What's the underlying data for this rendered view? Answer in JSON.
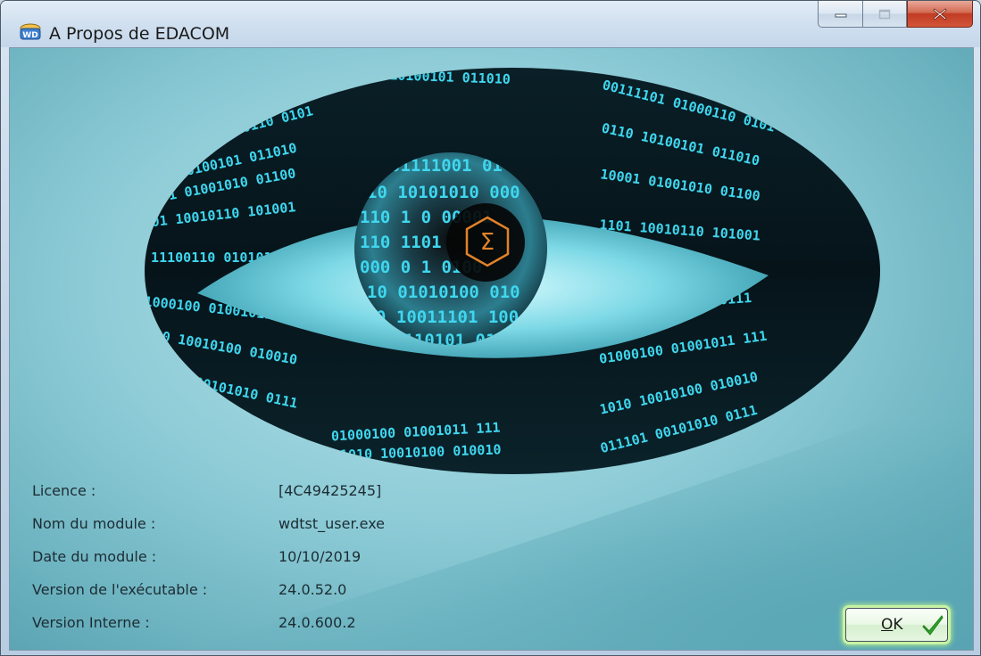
{
  "window": {
    "title": "A Propos de EDACOM",
    "app_icon": "windev-icon"
  },
  "caption_buttons": {
    "minimize": "minimize-icon",
    "maximize": "maximize-icon",
    "close": "close-icon"
  },
  "hero": {
    "description": "eye-graphic",
    "emblem_symbol": "Σ",
    "binary_rows": [
      "00111101 01000110 0101",
      "0110 10100101 011010",
      "10001 01001010 01100",
      "1101 10010110 101001",
      "0 11100110 01010111",
      "01000100 01001011 111",
      "1010 10010100 010010",
      "011101 00101010 0111"
    ],
    "iris_rows": [
      "01111001 01",
      "10 10101010 000",
      "110 1      0 00001",
      "110          1101",
      "000 0      1 0100",
      "10 01010100 010",
      "0 10011101 100",
      "1110101 01"
    ]
  },
  "info": {
    "licence_label": "Licence :",
    "licence_value": "[4C49425245]",
    "module_name_label": "Nom du module :",
    "module_name_value": "wdtst_user.exe",
    "module_date_label": "Date du module :",
    "module_date_value": "10/10/2019",
    "exe_version_label": "Version de l'exécutable :",
    "exe_version_value": "24.0.52.0",
    "internal_version_label": "Version Interne :",
    "internal_version_value": "24.0.600.2"
  },
  "ok_button": {
    "accel": "O",
    "rest": "K",
    "icon": "checkmark-icon"
  },
  "colors": {
    "accent_green": "#2fa82a",
    "emblem_orange": "#e2822a",
    "binary_cyan": "#3fd7ef"
  }
}
